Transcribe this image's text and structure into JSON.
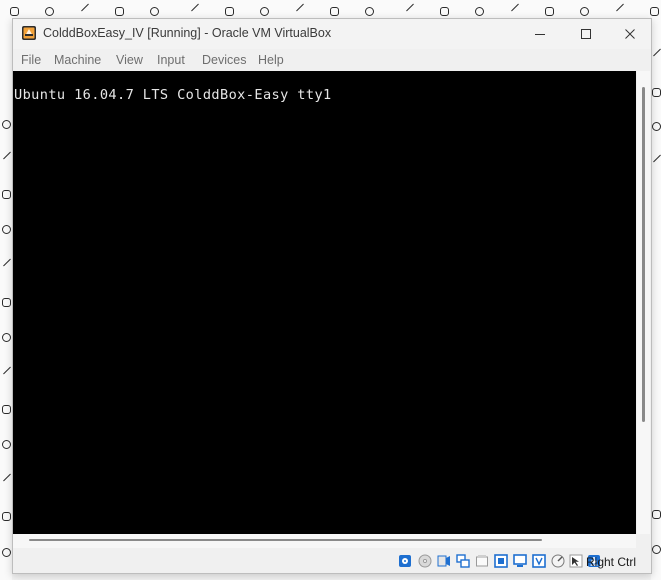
{
  "window": {
    "title": "ColddBoxEasy_IV [Running] - Oracle VM VirtualBox",
    "icon": "virtualbox-vm-icon",
    "controls": [
      "minimize-icon",
      "maximize-icon",
      "close-icon"
    ]
  },
  "menubar": {
    "items": [
      "File",
      "Machine",
      "View",
      "Input",
      "Devices",
      "Help"
    ]
  },
  "console": {
    "line1": "Ubuntu 16.04.7 LTS ColddBox-Easy tty1"
  },
  "statusbar": {
    "icons": [
      "hard-disk-icon",
      "optical-drive-icon",
      "audio-icon",
      "network-icon",
      "usb-icon",
      "shared-folders-icon",
      "display-icon",
      "video-capture-icon",
      "cpu-virtualization-icon",
      "mouse-integration-icon",
      "keyboard-capture-icon"
    ],
    "host_key": "Right Ctrl"
  },
  "colors": {
    "screen": "#000000",
    "console_text": "#e6e6e6",
    "chrome": "#f0f0f0",
    "status_icon_blue": "#1e6fd0"
  }
}
